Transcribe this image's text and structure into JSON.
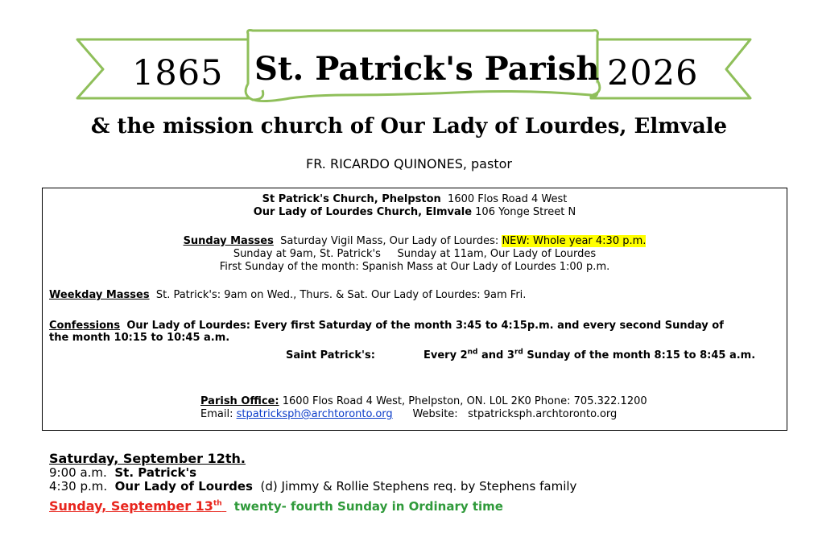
{
  "header": {
    "year_start": "1865",
    "year_end": "2026",
    "parish_title": "St. Patrick's Parish",
    "subtitle": "& the mission church of Our Lady of Lourdes, Elmvale",
    "pastor": "FR. RICARDO QUINONES, pastor",
    "banner_color": "#8fbf5a"
  },
  "info": {
    "church1_name": "St Patrick's Church, Phelpston",
    "church1_address": "1600 Flos Road 4 West",
    "church2_name": "Our Lady of Lourdes Church, Elmvale",
    "church2_address": "106 Yonge Street N",
    "sunday_label": "Sunday Masses",
    "sunday_text": "Saturday Vigil Mass, Our Lady of Lourdes:",
    "sunday_highlight": "NEW: Whole year 4:30 p.m.",
    "sunday_line2": "Sunday at 9am, St. Patrick's     Sunday at 11am, Our Lady of Lourdes",
    "sunday_line3": "First Sunday of the month: Spanish Mass at Our Lady of Lourdes 1:00 p.m.",
    "weekday_label": "Weekday Masses",
    "weekday_text": "St. Patrick's: 9am on Wed., Thurs. & Sat.   Our Lady of Lourdes: 9am Fri.",
    "confessions_label": "Confessions",
    "confessions_line1": "Our Lady of Lourdes: Every first Saturday of the month 3:45 to 4:15p.m. and  every second Sunday of",
    "confessions_line2": "the month 10:15 to 10:45 a.m.",
    "confessions_sp_label": "Saint Patrick's:",
    "confessions_sp_every": "Every 2",
    "confessions_sp_nd": "nd",
    "confessions_sp_and": " and 3",
    "confessions_sp_rd": "rd",
    "confessions_sp_rest": " Sunday of the month 8:15 to 8:45 a.m.",
    "office_label": "Parish Office:",
    "office_text": "1600 Flos Road 4 West, Phelpston, ON. L0L 2K0  Phone: 705.322.1200",
    "email_label": "Email:",
    "email": "stpatricksph@archtoronto.org",
    "website_label": "Website:",
    "website": "stpatricksph.archtoronto.org"
  },
  "schedule": {
    "saturday_heading": "Saturday, September 12th.",
    "sat_time1": "9:00 a.m.",
    "sat_place1": "St. Patrick's",
    "sat_time2": "4:30 p.m.",
    "sat_place2": "Our Lady of Lourdes",
    "sat_intention2": "(d) Jimmy & Rollie Stephens req. by Stephens family",
    "sunday_heading": "Sunday, September 13",
    "sunday_sup": "th",
    "sunday_desc": "twenty- fourth Sunday in Ordinary time",
    "sunday_heading_color": "#e8251d",
    "sunday_desc_color": "#2f9a3a"
  }
}
